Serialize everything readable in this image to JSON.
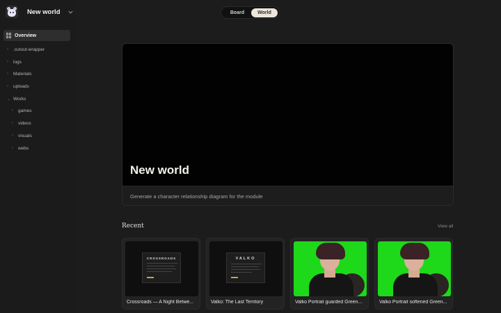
{
  "workspace": {
    "name": "New world",
    "avatar_icon": "bear-avatar-icon"
  },
  "nav": {
    "overview_label": "Overview",
    "tree": [
      {
        "label": ".cutout-wrapper"
      },
      {
        "label": "logs"
      },
      {
        "label": "Materials"
      },
      {
        "label": "uploads"
      },
      {
        "label": "Works"
      },
      {
        "label": "games"
      },
      {
        "label": "videos"
      },
      {
        "label": "visuals"
      },
      {
        "label": "webs"
      }
    ]
  },
  "toggle": {
    "options": [
      "Board",
      "World"
    ],
    "selected": "World"
  },
  "hero": {
    "title": "New world",
    "description": "Generate a character relationship diagram for the module"
  },
  "recent": {
    "title": "Recent",
    "view_all": "View all",
    "cards": [
      {
        "caption": "Crossroads — A Night Betwe...",
        "thumb_title": "CROSSROADS"
      },
      {
        "caption": "Valko: The Last Territory",
        "thumb_title": "VALKO"
      },
      {
        "caption": "Valko Portrait guarded Green..."
      },
      {
        "caption": "Valko Portrait softened Green..."
      }
    ]
  },
  "colors": {
    "background": "#1c1c1c",
    "accent": "#ece6da",
    "green_screen": "#1ed81a"
  }
}
